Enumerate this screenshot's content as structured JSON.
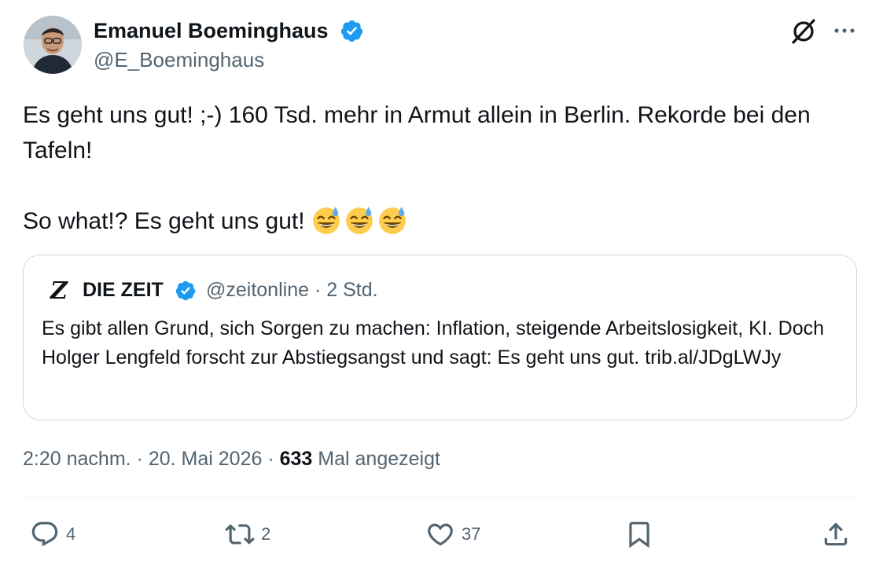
{
  "author": {
    "name": "Emanuel Boeminghaus",
    "handle": "@E_Boeminghaus",
    "verified_color": "#1d9bf0"
  },
  "tweet": {
    "line1": "Es geht uns gut! ;-) 160 Tsd. mehr in Armut allein in Berlin. Rekorde bei den Tafeln!",
    "line2": "So what!? Es geht uns gut!",
    "emoji": [
      "grinning-sweat-emoji",
      "grinning-sweat-emoji",
      "grinning-sweat-emoji"
    ]
  },
  "quote": {
    "logo_letter": "Z",
    "name": "DIE ZEIT",
    "handle": "@zeitonline",
    "separator": "·",
    "time": "2 Std.",
    "text": "Es gibt allen Grund, sich Sorgen zu machen: Inflation, steigende Arbeitslosigkeit, KI. Doch Holger Lengfeld forscht zur Abstiegsangst und sagt: Es geht uns gut. trib.al/JDgLWJy"
  },
  "meta": {
    "time": "2:20 nachm.",
    "separator": "·",
    "date": "20. Mai 2026",
    "views_count": "633",
    "views_label": "Mal angezeigt"
  },
  "actions": {
    "reply_count": "4",
    "retweet_count": "2",
    "like_count": "37"
  },
  "icons": {
    "grok": "grok-icon",
    "more": "more-icon",
    "reply": "reply-icon",
    "retweet": "retweet-icon",
    "like": "heart-icon",
    "bookmark": "bookmark-icon",
    "share": "share-icon"
  },
  "colors": {
    "text": "#0f1419",
    "secondary": "#536471",
    "border": "#cfd9de",
    "accent": "#1d9bf0"
  }
}
